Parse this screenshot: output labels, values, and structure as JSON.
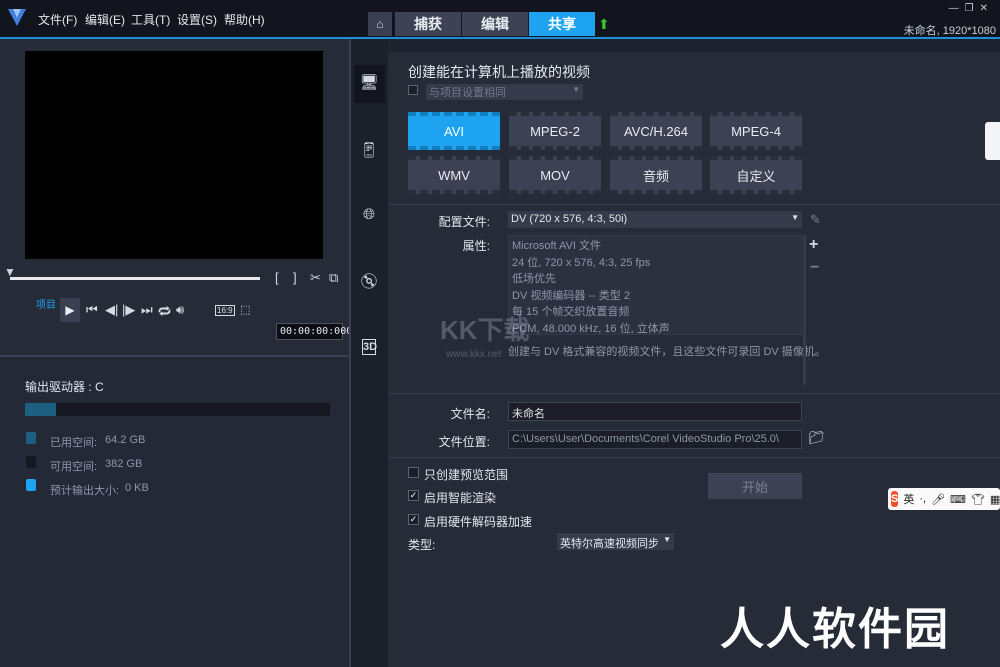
{
  "menu": {
    "file": "文件(F)",
    "edit": "编辑(E)",
    "tools": "工具(T)",
    "settings": "设置(S)",
    "help": "帮助(H)"
  },
  "tabs": {
    "capture": "捕获",
    "edit": "编辑",
    "share": "共享"
  },
  "project_name": "未命名, 1920*1080",
  "player": {
    "project_label": "项目",
    "timecode": "00:00:00:000",
    "ratio_label": "16:9"
  },
  "storage": {
    "drive_label": "输出驱动器 : C",
    "used_fraction": 0.1,
    "legend": [
      {
        "label": "已用空间:",
        "value": "64.2 GB",
        "color": "#1d5f80"
      },
      {
        "label": "可用空间:",
        "value": "382 GB",
        "color": "#151820"
      },
      {
        "label": "预计输出大小:",
        "value": "0 KB",
        "color": "#1ea3f0"
      }
    ]
  },
  "share": {
    "title": "创建能在计算机上播放的视频",
    "same_as_project": "与项目设置相同",
    "formats": [
      "AVI",
      "MPEG-2",
      "AVC/H.264",
      "MPEG-4",
      "WMV",
      "MOV",
      "音频",
      "自定义"
    ],
    "active_format": "AVI",
    "profile_label": "配置文件:",
    "profile_value": "DV (720 x 576, 4:3, 50i)",
    "props_label": "属性:",
    "props_lines": [
      "Microsoft AVI 文件",
      "24 位, 720 x 576, 4:3, 25 fps",
      "低场优先",
      "DV 视频编码器 -- 类型 2",
      "每 15 个帧交织放置音频",
      "PCM, 48.000 kHz, 16 位, 立体声"
    ],
    "props_desc": "创建与 DV 格式兼容的视频文件，且这些文件可录回 DV 摄像机。",
    "filename_label": "文件名:",
    "filename_value": "未命名",
    "filepath_label": "文件位置:",
    "filepath_value": "C:\\Users\\User\\Documents\\Corel VideoStudio Pro\\25.0\\",
    "option_preview": "只创建预览范围",
    "option_smart": "启用智能渲染",
    "option_hw": "启用硬件解码器加速",
    "start_label": "开始",
    "type_label": "类型:",
    "type_value": "英特尔高速视频同步"
  },
  "overlays": {
    "ime_lang": "英",
    "watermark_text": "人人软件园",
    "watermark_logo": "KK下载",
    "watermark_url": "www.kkx.net"
  }
}
